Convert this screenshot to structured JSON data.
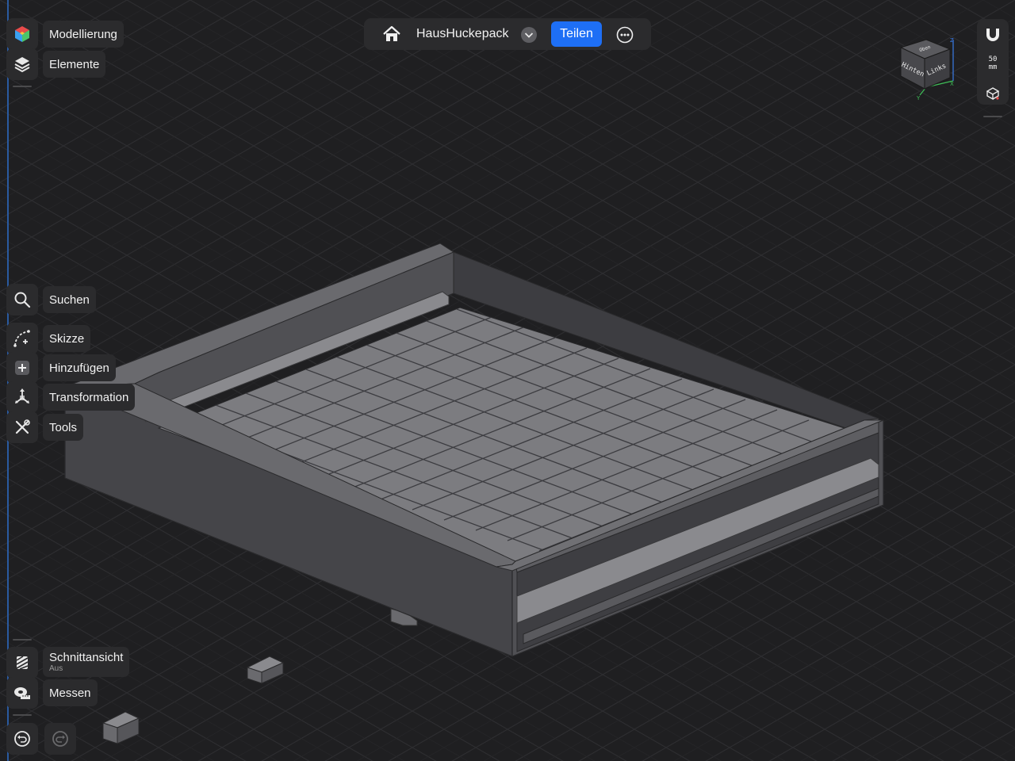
{
  "toolbar_top": {
    "modeling_label": "Modellierung",
    "elements_label": "Elemente"
  },
  "toolbar_mid": {
    "search_label": "Suchen",
    "sketch_label": "Skizze",
    "add_label": "Hinzufügen",
    "transform_label": "Transformation",
    "tools_label": "Tools"
  },
  "toolbar_bottom": {
    "section_label": "Schnittansicht",
    "section_state": "Aus",
    "measure_label": "Messen"
  },
  "topbar": {
    "document_title": "HausHuckepack",
    "share_label": "Teilen"
  },
  "view_cube": {
    "face_top": "Oben",
    "face_back": "Hinten",
    "face_left": "Links",
    "axis_x": "X",
    "axis_y": "Y",
    "axis_z": "Z"
  },
  "right_panel": {
    "scale_value": "50",
    "scale_unit": "mm"
  },
  "colors": {
    "background": "#1f1f21",
    "panel": "#2b2b2d",
    "accent": "#1e6ff5",
    "model_face": "#56565a",
    "model_floor": "#7a7a7e"
  },
  "icons": {
    "modeling": "color-cube-icon",
    "elements": "layers-icon",
    "search": "magnifier-icon",
    "sketch": "sketch-curve-icon",
    "add": "plus-square-icon",
    "transform": "move-axes-icon",
    "tools": "tools-icon",
    "section": "section-view-icon",
    "measure": "tape-measure-icon",
    "undo": "undo-icon",
    "redo": "redo-icon",
    "home": "home-icon",
    "dropdown": "chevron-down-icon",
    "more": "more-icon",
    "magnet": "magnet-icon",
    "view": "view-cube-small-icon"
  }
}
